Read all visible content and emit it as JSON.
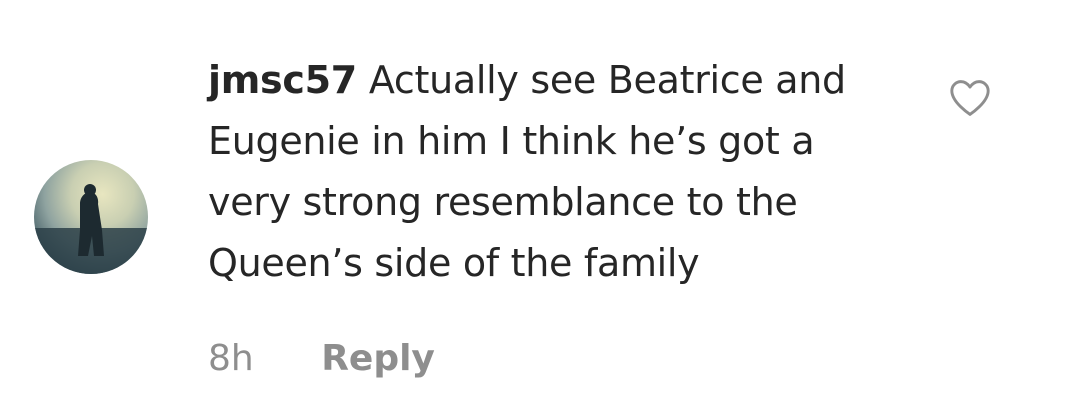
{
  "comment": {
    "username": "jmsc57",
    "text_lines": [
      "Actually see Beatrice and",
      "Eugenie in him I think he’s got a",
      "very strong resemblance to the",
      "Queen’s side of the family"
    ],
    "timestamp": "8h",
    "reply_label": "Reply",
    "like_icon": "heart-outline-icon",
    "avatar_icon": "profile-photo"
  }
}
